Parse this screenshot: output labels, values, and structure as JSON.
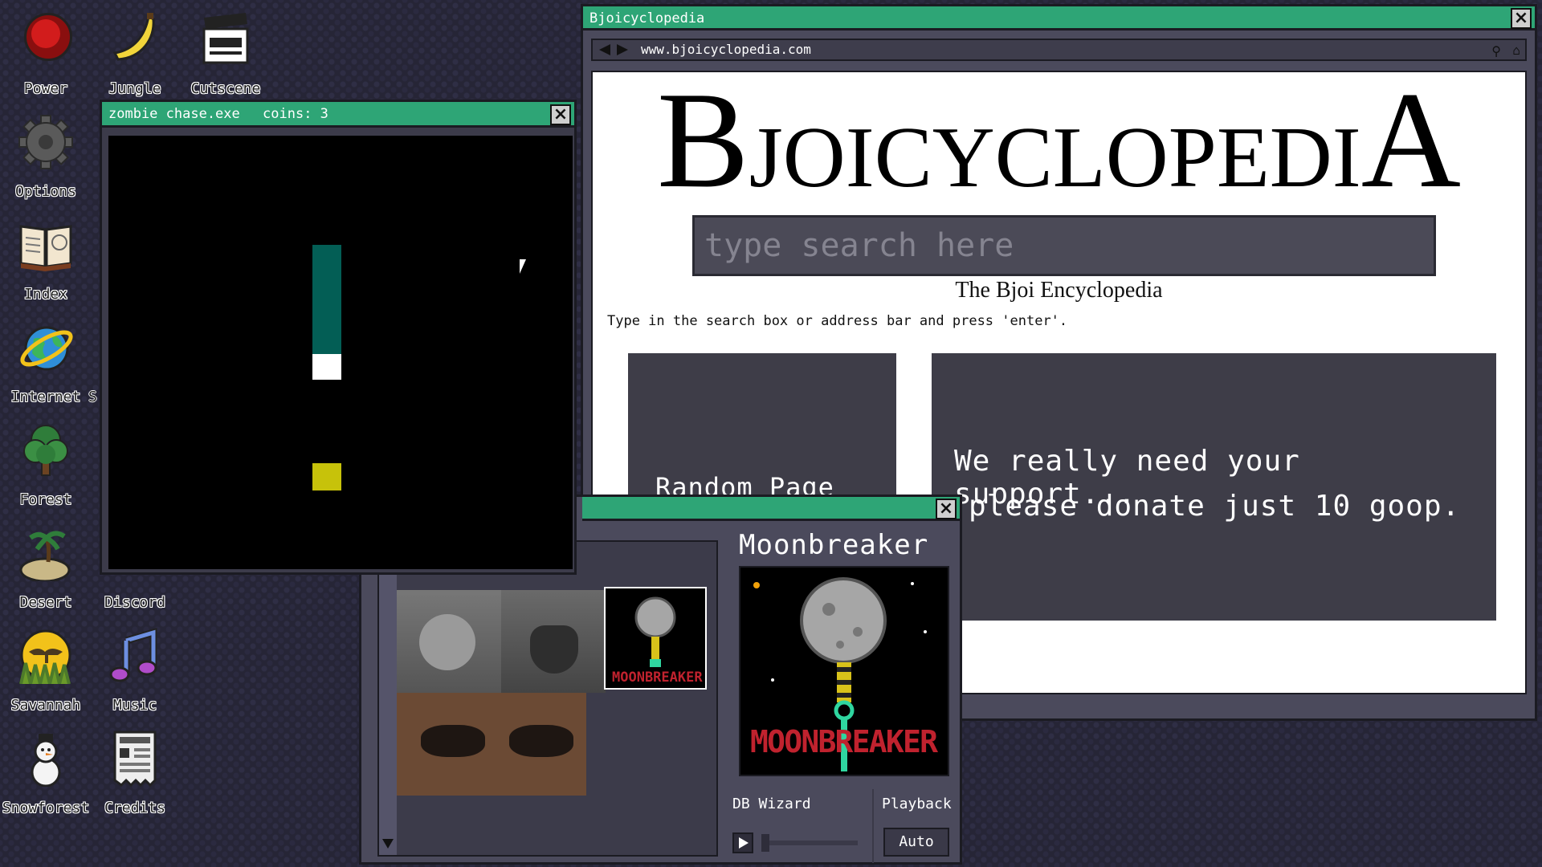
{
  "desktop": {
    "icons": [
      {
        "label": "Power"
      },
      {
        "label": "Jungle"
      },
      {
        "label": "Cutscene"
      },
      {
        "label": "Options"
      },
      {
        "label": "Index"
      },
      {
        "label": "Internet"
      },
      {
        "label": "Forest"
      },
      {
        "label": "Desert"
      },
      {
        "label": "Discord"
      },
      {
        "label": "Savannah"
      },
      {
        "label": "Music"
      },
      {
        "label": "Snowforest"
      },
      {
        "label": "Credits"
      }
    ],
    "partial_label": "S"
  },
  "game_window": {
    "title": "zombie chase.exe",
    "coins_text": "coins: 3",
    "colors": {
      "player": "#035e55",
      "zombie_head": "#ffffff",
      "coin": "#c7c20a"
    }
  },
  "browser": {
    "title": "Bjoicyclopedia",
    "url": "www.bjoicyclopedia.com",
    "logo": {
      "first": "B",
      "middle": "JOICYCLOPEDI",
      "last": "A"
    },
    "search_placeholder": "type search here",
    "subtitle": "The Bjoi Encyclopedia",
    "instructions": "Type in the search box or address bar and press 'enter'.",
    "random_page": "Random Page",
    "support_line1": "We really need your support...",
    "support_line2": "please donate just 10 goop."
  },
  "music_window": {
    "track_title": "Moonbreaker",
    "artist": "DB Wizard",
    "playback_label": "Playback",
    "playback_mode": "Auto",
    "album_text": "MOONBREAKER"
  }
}
